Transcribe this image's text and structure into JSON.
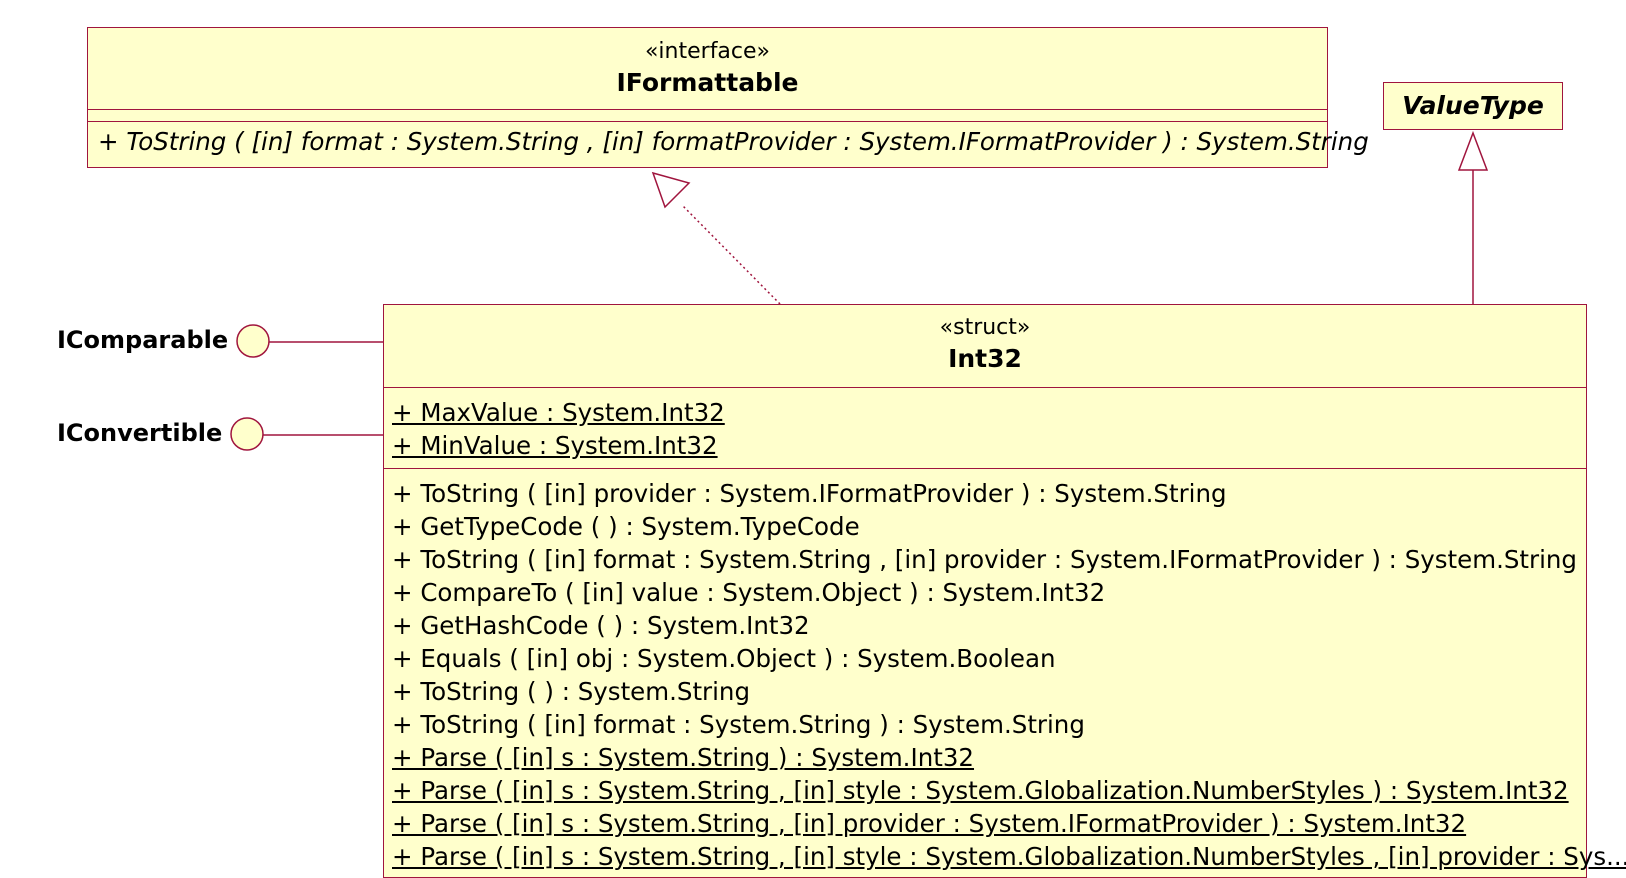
{
  "iformattable": {
    "stereotype": "«interface»",
    "name": "IFormattable",
    "operations": [
      "+ ToString ( [in] format : System.String , [in] formatProvider : System.IFormatProvider ) : System.String"
    ]
  },
  "valuetype": {
    "name": "ValueType"
  },
  "int32": {
    "stereotype": "«struct»",
    "name": "Int32",
    "attributes": [
      "+ MaxValue : System.Int32",
      "+ MinValue : System.Int32"
    ],
    "operations": [
      "+ ToString ( [in] provider : System.IFormatProvider ) : System.String",
      "+ GetTypeCode (  ) : System.TypeCode",
      "+ ToString ( [in] format : System.String , [in] provider : System.IFormatProvider ) : System.String",
      "+ CompareTo ( [in] value : System.Object ) : System.Int32",
      "+ GetHashCode (  ) : System.Int32",
      "+ Equals ( [in] obj : System.Object ) : System.Boolean",
      "+ ToString (  ) : System.String",
      "+ ToString ( [in] format : System.String ) : System.String",
      "+ Parse ( [in] s : System.String ) : System.Int32",
      "+ Parse ( [in] s : System.String , [in] style : System.Globalization.NumberStyles ) : System.Int32",
      "+ Parse ( [in] s : System.String , [in] provider : System.IFormatProvider ) : System.Int32",
      "+ Parse ( [in] s : System.String , [in] style : System.Globalization.NumberStyles , [in] provider : Sys..."
    ]
  },
  "lollipops": {
    "icomparable": "IComparable",
    "iconvertible": "IConvertible"
  },
  "colors": {
    "fill": "#ffffcc",
    "stroke": "#a0153e"
  }
}
